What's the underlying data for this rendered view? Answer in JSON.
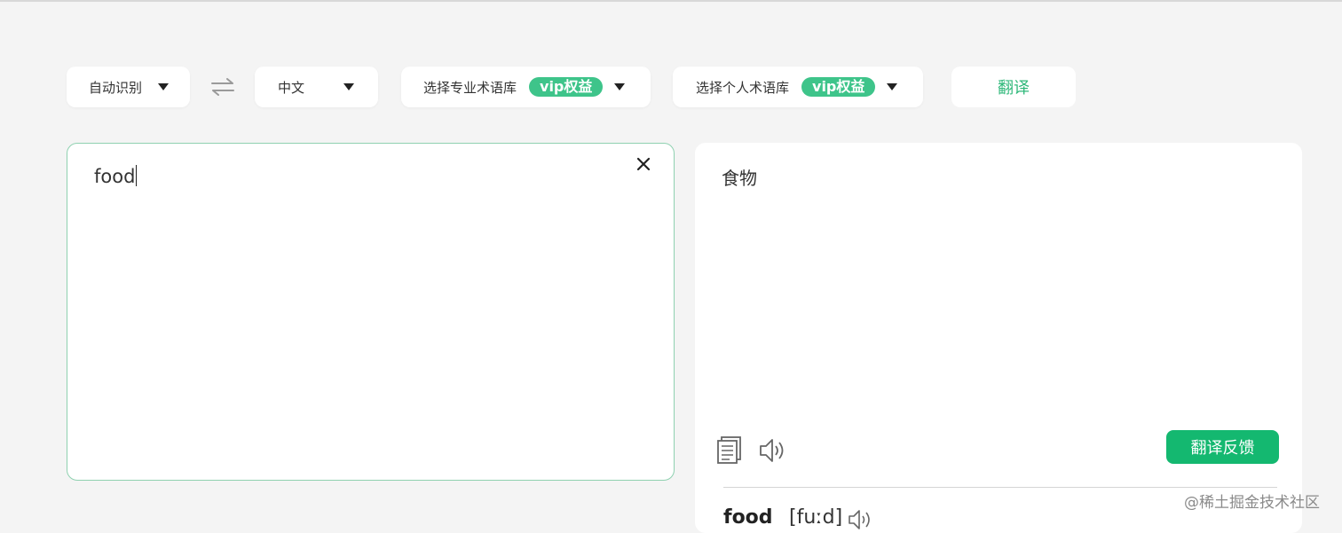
{
  "toolbar": {
    "source_lang": "自动识别",
    "target_lang": "中文",
    "term_library": "选择专业术语库",
    "term_vip": "vip权益",
    "personal_library": "选择个人术语库",
    "personal_vip": "vip权益",
    "translate_label": "翻译"
  },
  "source": {
    "text": "food"
  },
  "result": {
    "text": "食物",
    "feedback_label": "翻译反馈"
  },
  "dictionary": {
    "word": "food",
    "phonetic": "[fuːd]"
  },
  "watermark": "@稀土掘金技术社区",
  "colors": {
    "accent": "#14b870",
    "vip_badge": "#3ec48a",
    "border_focus": "#8fd1b0",
    "background": "#f4f4f4"
  },
  "icons": {
    "swap": "swap-arrows-icon",
    "clear": "close-icon",
    "copy": "copy-icon",
    "speaker": "speaker-icon"
  }
}
